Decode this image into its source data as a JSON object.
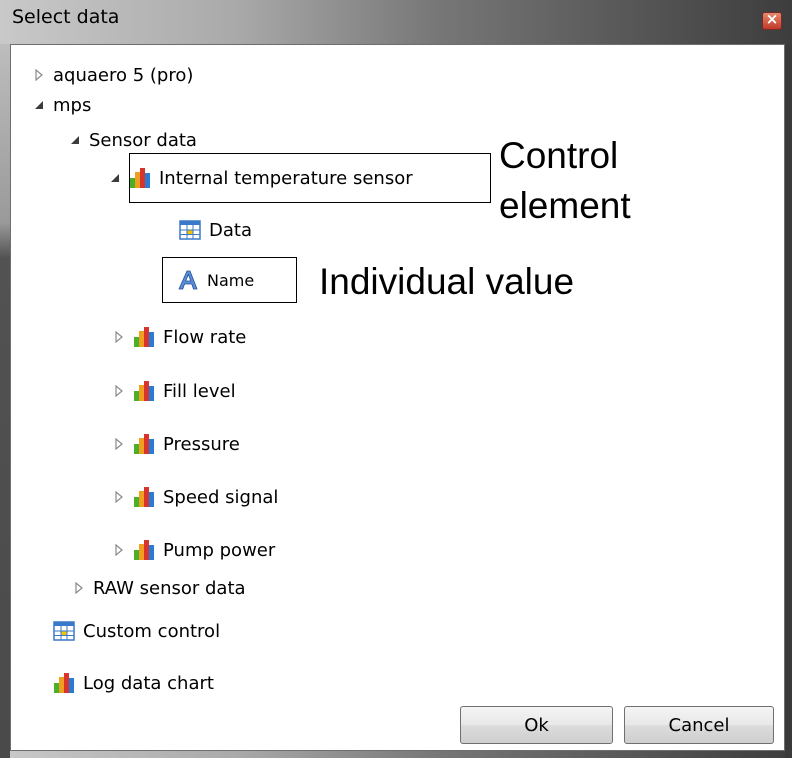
{
  "window": {
    "title": "Select data"
  },
  "tree": {
    "aquaero": "aquaero 5 (pro)",
    "mps": "mps",
    "sensor_data": "Sensor data",
    "internal_temp": "Internal temperature sensor",
    "data": "Data",
    "name": "Name",
    "flow_rate": "Flow rate",
    "fill_level": "Fill level",
    "pressure": "Pressure",
    "speed_signal": "Speed signal",
    "pump_power": "Pump power",
    "raw_sensor_data": "RAW sensor data",
    "custom_control": "Custom control",
    "log_data_chart": "Log data chart"
  },
  "annotations": {
    "control_element_line1": "Control",
    "control_element_line2": "element",
    "individual_value": "Individual value"
  },
  "buttons": {
    "ok": "Ok",
    "cancel": "Cancel"
  },
  "icons": {
    "expander_collapsed": "triangle-right-outline-icon",
    "expander_expanded": "triangle-down-filled-icon",
    "sensor": "bar-chart-icon",
    "data": "table-icon",
    "name": "text-A-icon"
  },
  "colors": {
    "bar_red": "#d9342b",
    "bar_orange": "#f0a020",
    "bar_green": "#4caf2a",
    "bar_blue": "#2a7bd4",
    "close_button": "#c0392b"
  }
}
